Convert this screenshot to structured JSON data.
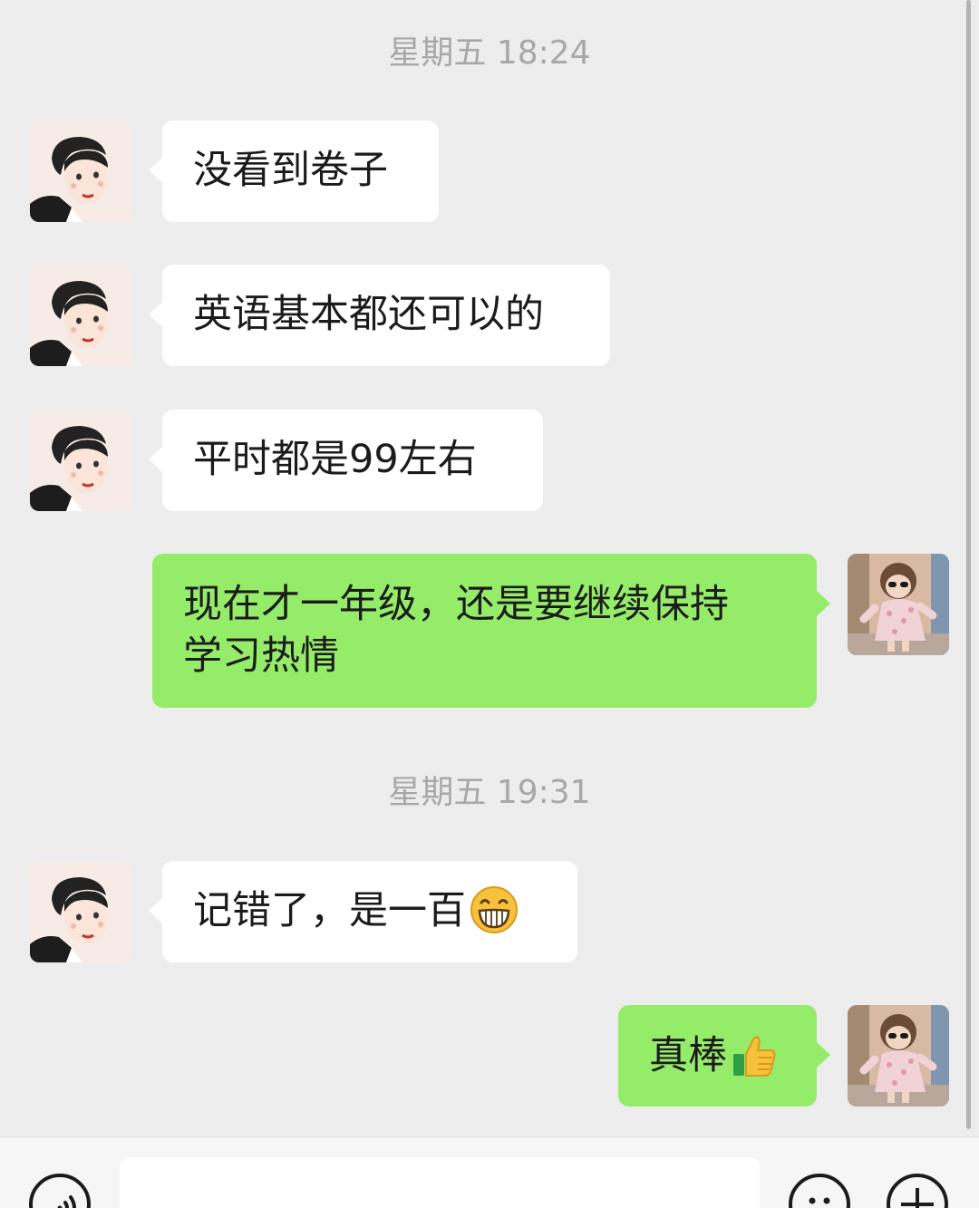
{
  "timestamps": [
    "星期五 18:24",
    "星期五 19:31"
  ],
  "messages": [
    {
      "side": "in",
      "text": "没看到卷子"
    },
    {
      "side": "in",
      "text": "英语基本都还可以的"
    },
    {
      "side": "in",
      "text": "平时都是99左右"
    },
    {
      "side": "out",
      "line1": "现在才一年级，还是要继续保持",
      "line2": "学习热情"
    },
    {
      "side": "in",
      "text": "记错了，是一百",
      "emoji": "grinning-face-emoji"
    },
    {
      "side": "out",
      "text": "真棒",
      "emoji": "thumbs-up-emoji"
    }
  ],
  "colors": {
    "background": "#ededed",
    "incoming_bubble": "#ffffff",
    "outgoing_bubble": "#95ec69",
    "timestamp_text": "#a8a8a8",
    "message_text": "#1b1b1b"
  },
  "input_bar": {
    "voice_icon": "voice-icon",
    "emoji_icon": "emoji-icon",
    "plus_icon": "plus-icon"
  }
}
